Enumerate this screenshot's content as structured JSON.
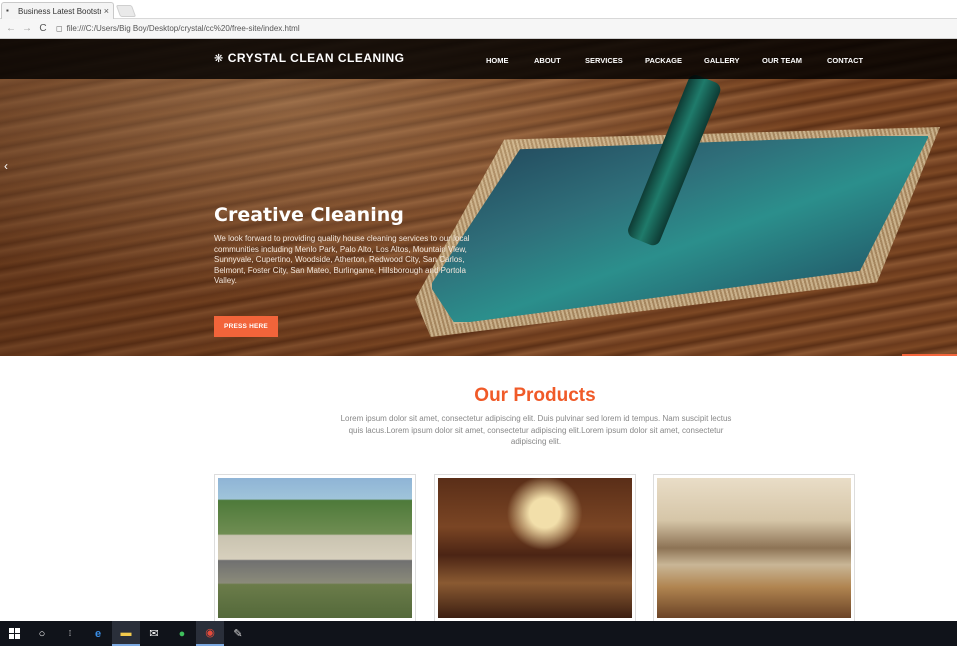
{
  "browser": {
    "tab_title": "Business Latest Bootstra",
    "tab_close": "×",
    "address": "file:///C:/Users/Big Boy/Desktop/crystal/cc%20/free-site/index.html",
    "back": "←",
    "forward": "→",
    "reload": "C"
  },
  "site": {
    "logo_text": "CRYSTAL CLEAN CLEANING",
    "nav": [
      "HOME",
      "ABOUT",
      "SERVICES",
      "PACKAGE",
      "GALLERY",
      "OUR TEAM",
      "CONTACT"
    ],
    "prev_arrow": "‹",
    "hero": {
      "title": "Creative Cleaning",
      "description": "We look forward to providing quality house cleaning services to our local communities including Menlo Park, Palo Alto, Los Altos, Mountain View, Sunnyvale, Cupertino, Woodside, Atherton, Redwood City, San Carlos, Belmont, Foster City, San Mateo, Burlingame, Hillsborough and Portola Valley.",
      "button_label": "PRESS HERE"
    },
    "products": {
      "title": "Our Products",
      "description": "Lorem ipsum dolor sit amet, consectetur adipiscing elit. Duis pulvinar sed lorem id tempus. Nam suscipit lectus quis lacus.Lorem ipsum dolor sit amet, consectetur adipiscing elit.Lorem ipsum dolor sit amet, consectetur adipiscing elit."
    }
  },
  "taskbar": {
    "items": [
      "start",
      "search",
      "task-view",
      "edge",
      "file-explorer",
      "mail",
      "green-app",
      "chrome",
      "paint"
    ]
  },
  "colors": {
    "accent": "#f2643a",
    "products_title": "#f05a28",
    "nav_bg": "#000000"
  }
}
